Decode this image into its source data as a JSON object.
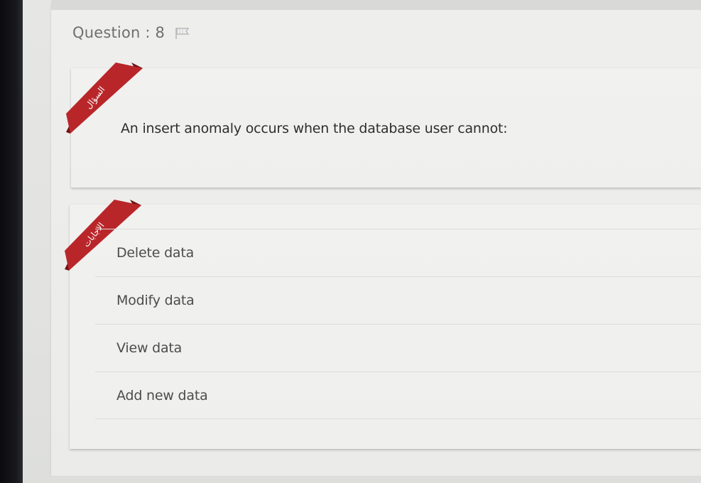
{
  "question": {
    "header_label": "Question : 8",
    "flag_icon": "flag-icon",
    "ribbon_text": "السؤال",
    "text": "An insert anomaly occurs when the database user cannot:"
  },
  "answers": {
    "ribbon_text": "الاجابات",
    "options": [
      {
        "label": "Delete data"
      },
      {
        "label": "Modify data"
      },
      {
        "label": "View data"
      },
      {
        "label": "Add new data"
      }
    ]
  },
  "colors": {
    "ribbon": "#b9262a",
    "ribbon_shadow": "#6e1214",
    "card": "#efefed",
    "text": "#2e2e30"
  }
}
